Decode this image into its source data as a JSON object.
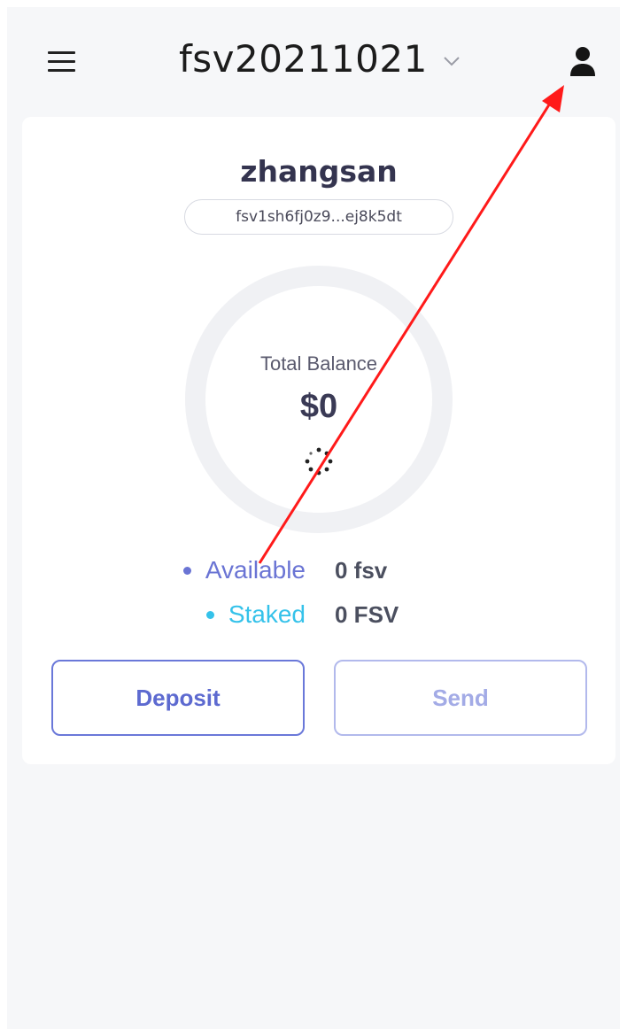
{
  "header": {
    "menu_icon": "hamburger-icon",
    "network": "fsv20211021",
    "chevron_icon": "chevron-down-icon",
    "profile_icon": "user-icon"
  },
  "account": {
    "name": "zhangsan",
    "address": "fsv1sh6fj0z9...ej8k5dt"
  },
  "balance": {
    "label": "Total Balance",
    "value": "$0",
    "loading_icon": "spinner-icon"
  },
  "legend": [
    {
      "label": "Available",
      "value": "0 fsv",
      "color": "#6a74d4"
    },
    {
      "label": "Staked",
      "value": "0 FSV",
      "color": "#35c2ea"
    }
  ],
  "actions": {
    "deposit": "Deposit",
    "send": "Send"
  },
  "colors": {
    "accent": "#5d6ad0",
    "accent_light": "#a3abe6",
    "annotation": "#ff1a1a"
  }
}
